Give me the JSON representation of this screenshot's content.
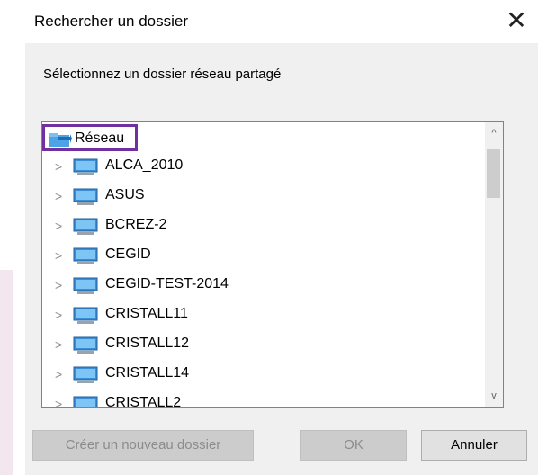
{
  "dialog": {
    "title": "Rechercher un dossier",
    "close_glyph": "✕",
    "instruction": "Sélectionnez un dossier réseau partagé"
  },
  "tree": {
    "root": {
      "label": "Réseau",
      "icon": "network-folder-icon",
      "highlight_color": "#7030a0"
    },
    "items": [
      {
        "label": "ALCA_2010",
        "icon": "computer-icon"
      },
      {
        "label": "ASUS",
        "icon": "computer-icon"
      },
      {
        "label": "BCREZ-2",
        "icon": "computer-icon"
      },
      {
        "label": "CEGID",
        "icon": "computer-icon"
      },
      {
        "label": "CEGID-TEST-2014",
        "icon": "computer-icon"
      },
      {
        "label": "CRISTALL11",
        "icon": "computer-icon"
      },
      {
        "label": "CRISTALL12",
        "icon": "computer-icon"
      },
      {
        "label": "CRISTALL14",
        "icon": "computer-icon"
      },
      {
        "label": "CRISTALL2",
        "icon": "computer-icon"
      }
    ],
    "scroll_up_glyph": "^",
    "scroll_down_glyph": "v"
  },
  "buttons": {
    "new_folder": "Créer un nouveau dossier",
    "ok": "OK",
    "cancel": "Annuler"
  }
}
